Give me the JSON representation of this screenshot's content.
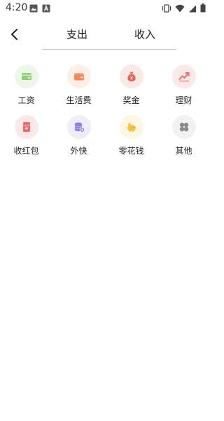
{
  "status_bar": {
    "time": "4:20",
    "left_icons": [
      "image-icon",
      "a-icon"
    ],
    "right_icons": [
      "vibrate-icon",
      "wifi-icon",
      "signal-icon",
      "battery-icon"
    ]
  },
  "header": {
    "tabs": [
      {
        "label": "支出"
      },
      {
        "label": "收入"
      }
    ]
  },
  "categories": [
    {
      "label": "工资",
      "icon": "wallet-card-icon",
      "color": "#8fce7a",
      "bg": "#eef6ea"
    },
    {
      "label": "生活费",
      "icon": "purse-icon",
      "color": "#f08a5d",
      "bg": "#fdeee8"
    },
    {
      "label": "奖金",
      "icon": "money-bag-icon",
      "color": "#e8615a",
      "bg": "#fbe9e8"
    },
    {
      "label": "理财",
      "icon": "trend-up-icon",
      "color": "#ec6b6b",
      "bg": "#fbe9ea"
    },
    {
      "label": "收红包",
      "icon": "red-envelope-icon",
      "color": "#ef6a6a",
      "bg": "#fbe9e9"
    },
    {
      "label": "外快",
      "icon": "coin-stack-icon",
      "color": "#8c7ee0",
      "bg": "#efedfa"
    },
    {
      "label": "零花钱",
      "icon": "piggy-bank-icon",
      "color": "#f5c24c",
      "bg": "#fdf6e3"
    },
    {
      "label": "其他",
      "icon": "four-dots-icon",
      "color": "#8a8a8a",
      "bg": "#f2f2f2"
    }
  ]
}
